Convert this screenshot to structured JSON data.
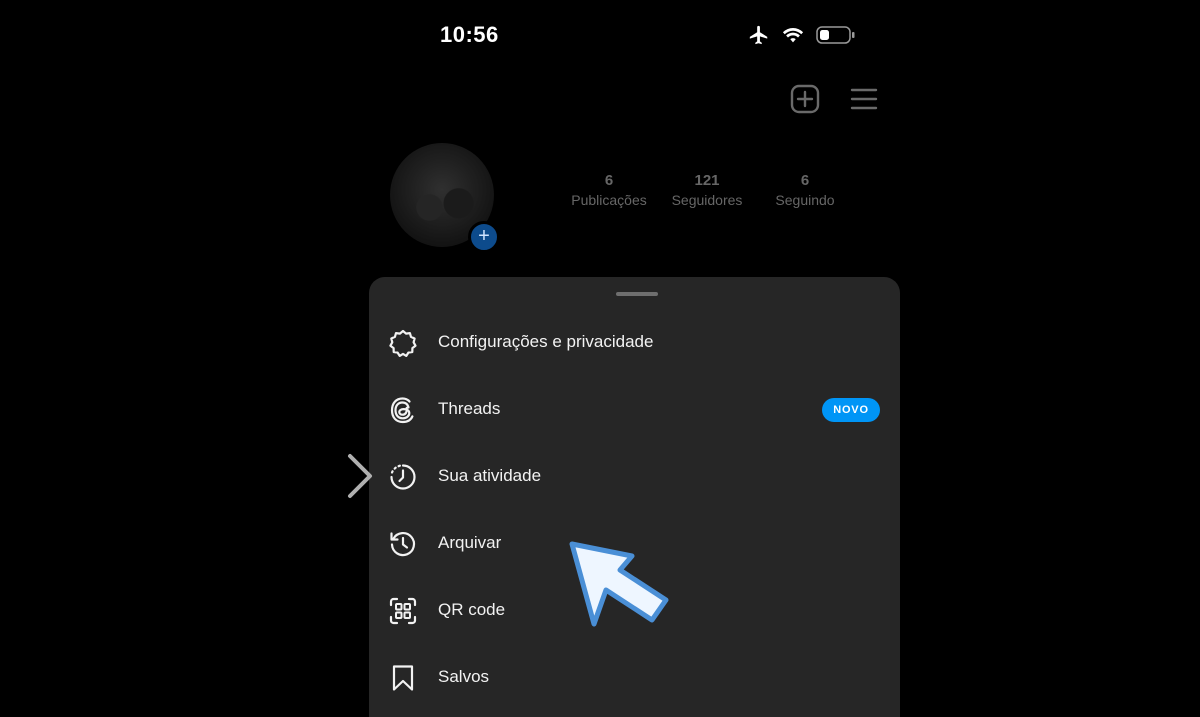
{
  "status_bar": {
    "time": "10:56",
    "icons": [
      "airplane-icon",
      "wifi-icon",
      "battery-icon"
    ]
  },
  "header_actions": [
    "new-post-icon",
    "menu-icon"
  ],
  "profile": {
    "stats": [
      {
        "value": "6",
        "label": "Publicações"
      },
      {
        "value": "121",
        "label": "Seguidores"
      },
      {
        "value": "6",
        "label": "Seguindo"
      }
    ]
  },
  "menu": {
    "items": [
      {
        "label": "Configurações e privacidade",
        "icon": "settings-icon"
      },
      {
        "label": "Threads",
        "icon": "threads-icon",
        "badge": "NOVO"
      },
      {
        "label": "Sua atividade",
        "icon": "activity-icon"
      },
      {
        "label": "Arquivar",
        "icon": "archive-icon"
      },
      {
        "label": "QR code",
        "icon": "qr-code-icon"
      },
      {
        "label": "Salvos",
        "icon": "bookmark-icon"
      }
    ]
  },
  "colors": {
    "background": "#000000",
    "sheet": "#262626",
    "badge": "#0095f6",
    "cursor_outline": "#4a8fd6"
  }
}
